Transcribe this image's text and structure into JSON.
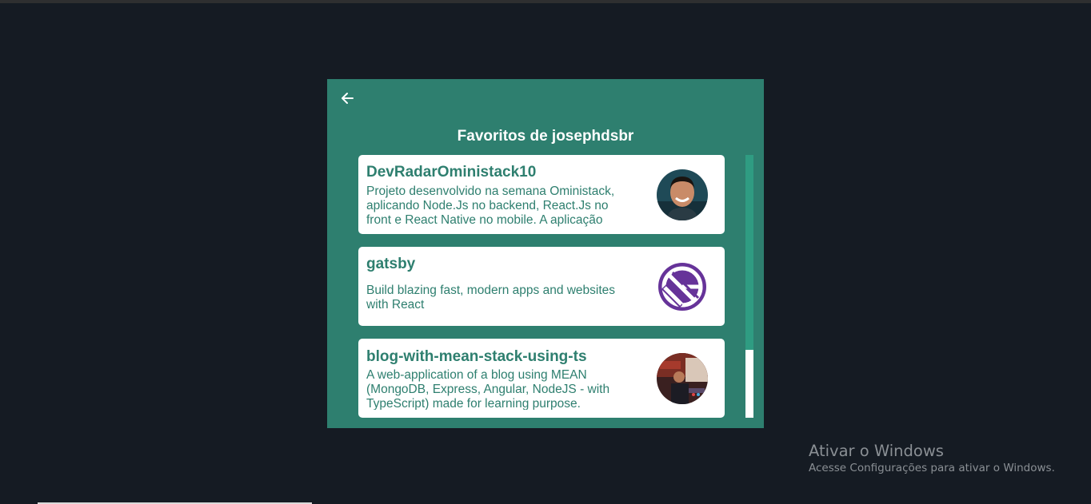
{
  "header": {
    "title": "Favoritos de josephdsbr",
    "back_icon": "arrow-left-icon"
  },
  "favorites": [
    {
      "name": "DevRadarOministack10",
      "description": "Projeto desenvolvido na semana Oministack, aplicando Node.Js no backend, React.Js no front e React Native no mobile. A aplicação",
      "avatar": "user-photo"
    },
    {
      "name": "gatsby",
      "description": "Build blazing fast, modern apps and websites with React",
      "avatar": "gatsby-logo-icon"
    },
    {
      "name": "blog-with-mean-stack-using-ts",
      "description": "A web-application of a blog using MEAN (MongoDB, Express, Angular, NodeJS - with TypeScript) made for learning purpose.",
      "avatar": "user-photo"
    }
  ],
  "scroll": {
    "position": 0.74
  },
  "windows_activation": {
    "title": "Ativar o Windows",
    "subtitle": "Acesse Configurações para ativar o Windows."
  },
  "colors": {
    "background": "#151b23",
    "panel": "#2e7f6f",
    "card": "#ffffff",
    "accent_text": "#2e7f6f",
    "gatsby_purple": "#663399"
  }
}
